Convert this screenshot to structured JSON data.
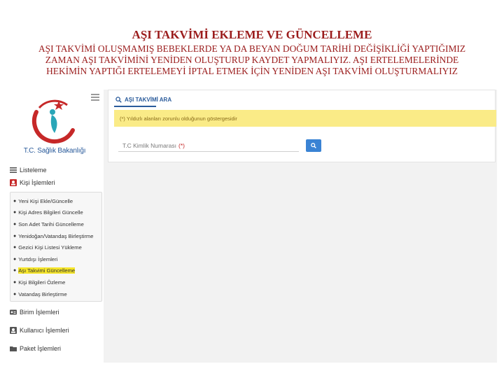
{
  "slide": {
    "title": "AŞI TAKVİMİ EKLEME VE GÜNCELLEME",
    "description": "AŞI TAKVİMİ OLUŞMAMIŞ BEBEKLERDE YA DA BEYAN DOĞUM TARİHİ DEĞİŞİKLİĞİ YAPTIĞIMIZ ZAMAN AŞI TAKVİMİNİ YENİDEN OLUŞTURUP KAYDET YAPMALIYIZ. AŞI ERTELEMELERİNDE HEKİMİN YAPTIĞI ERTELEMEYİ İPTAL ETMEK İÇİN YENİDEN AŞI TAKVİMİ OLUŞTURMALIYIZ"
  },
  "sidebar": {
    "logo_text": "T.C. Sağlık Bakanlığı",
    "menu": {
      "listeleme": "Listeleme",
      "kisi_islemleri": "Kişi İşlemleri",
      "sub_items": [
        "Yeni Kişi Ekle/Güncelle",
        "Kişi Adres Bilgileri Güncelle",
        "Son Adet Tarihi Güncelleme",
        "Yenidoğan/Vatandaş Birleştirme",
        "Gezici Kişi Listesi Yükleme",
        "Yurtdışı İşlemleri",
        "Aşı Takvimi Güncelleme",
        "Kişi Bilgileri Özleme",
        "Vatandaş Birleştirme"
      ],
      "birim_islemleri": "Birim İşlemleri",
      "kullanici_islemleri": "Kullanıcı İşlemleri",
      "paket_islemleri": "Paket İşlemleri"
    }
  },
  "panel": {
    "heading": "AŞI TAKVİMİ ARA",
    "warning": "(*) Yıldızlı alanları zorunlu olduğunun göstergesidir",
    "tc_placeholder": "T.C Kimlik Numarası",
    "required_mark": "(*)"
  },
  "colors": {
    "title_red": "#9b1c1c",
    "brand_blue": "#2a5b9b",
    "warning_yellow": "#faeb87",
    "highlight_yellow": "#f5e52a",
    "button_blue": "#3a83d4"
  }
}
